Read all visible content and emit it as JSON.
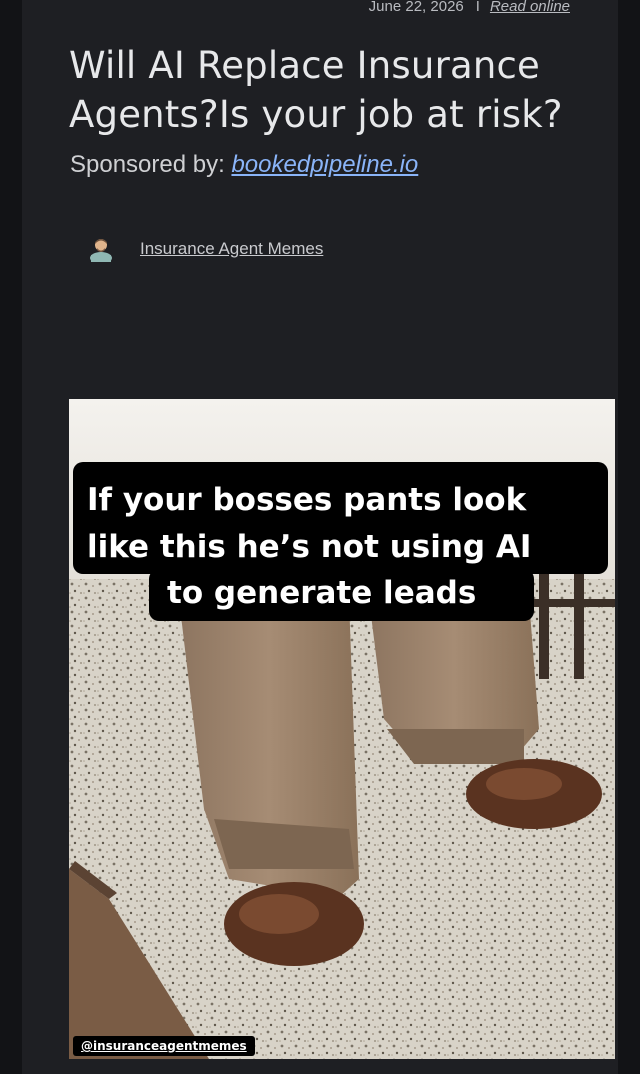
{
  "meta": {
    "date": "June 22, 2026",
    "separator": "I",
    "read_online": "Read online"
  },
  "article": {
    "title": "Will AI Replace Insurance Agents?Is your job at risk?",
    "sponsor_label": "Sponsored by:",
    "sponsor_link": "bookedpipeline.io",
    "author": "Insurance Agent Memes"
  },
  "meme": {
    "caption_lines": [
      "If your bosses pants look",
      "like this he’s not using AI",
      "to generate leads"
    ],
    "watermark": "@insuranceagentmemes"
  },
  "colors": {
    "background": "#121316",
    "panel": "#1e1f23",
    "link": "#8ab4f8",
    "title": "#e7e8ea"
  },
  "icons": {
    "author_avatar": "person-avatar-icon"
  }
}
